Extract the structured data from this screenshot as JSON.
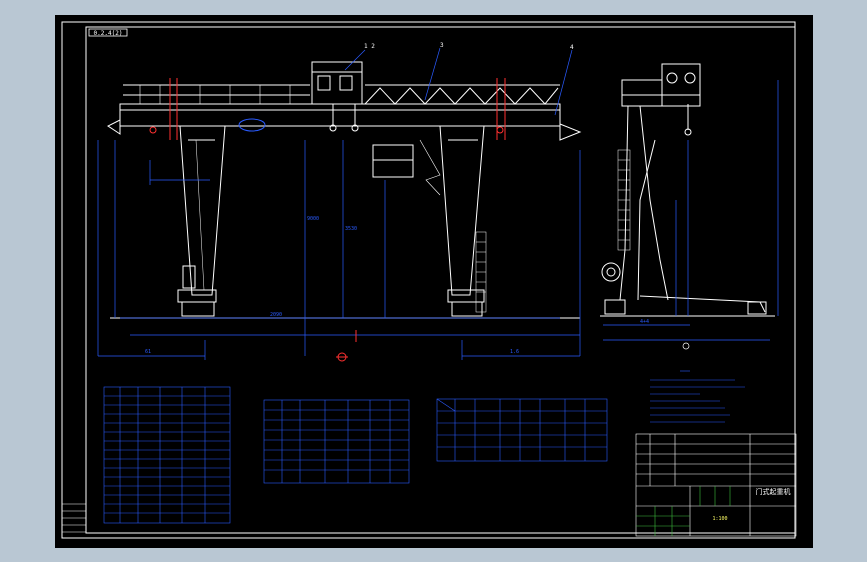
{
  "app": {
    "background": "#b9c7d3",
    "canvas": "#000000"
  },
  "drawing": {
    "stamp_label": "0.2.4(2)",
    "callouts": [
      "1 2",
      "3",
      "4"
    ],
    "dims": {
      "d1": "2090",
      "d2": "9",
      "d3": "7000",
      "h1": "3530",
      "h2": "9000",
      "left_span": "61",
      "right_span": "1.6",
      "side_width": "4+4"
    },
    "title_block": {
      "drawing_title": "门式起重机",
      "scale": "1:100"
    }
  },
  "colors": {
    "frame": "#ffffff",
    "structure": "#ffffff",
    "dimension": "#2a5bff",
    "centerline": "#ff3030",
    "text": "#ffffff",
    "accent": "#ffff66"
  }
}
